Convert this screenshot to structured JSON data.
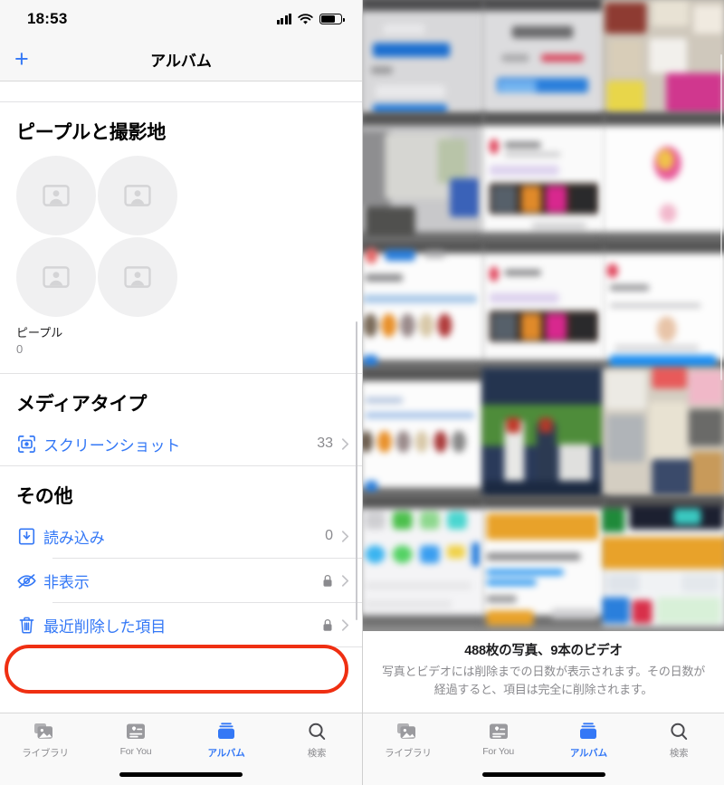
{
  "left": {
    "status": {
      "time": "18:53",
      "signal_icon": "cellular-signal-icon",
      "wifi_icon": "wifi-icon",
      "battery_icon": "battery-icon"
    },
    "nav": {
      "add_label": "+",
      "title": "アルバム"
    },
    "sections": [
      {
        "heading": "ピープルと撮影地",
        "people_album": {
          "label": "ピープル",
          "count": "0"
        }
      },
      {
        "heading": "メディアタイプ",
        "rows": [
          {
            "icon": "screenshot-icon",
            "label": "スクリーンショット",
            "value": "33",
            "locked": false
          }
        ]
      },
      {
        "heading": "その他",
        "rows": [
          {
            "icon": "import-icon",
            "label": "読み込み",
            "value": "0",
            "locked": false
          },
          {
            "icon": "eye-slash-icon",
            "label": "非表示",
            "value": "",
            "locked": true
          },
          {
            "icon": "trash-icon",
            "label": "最近削除した項目",
            "value": "",
            "locked": true
          }
        ]
      }
    ],
    "cut_values": [
      "0",
      "0",
      "0"
    ],
    "highlight": {
      "color": "#ef2f12",
      "target": "最近削除した項目"
    }
  },
  "right": {
    "footer": {
      "title": "488枚の写真、9本のビデオ",
      "description": "写真とビデオには削除までの日数が表示されます。その日数が経過すると、項目は完全に削除されます。"
    }
  },
  "tabs": [
    {
      "label": "ライブラリ",
      "icon": "photos-library-icon",
      "active": false
    },
    {
      "label": "For You",
      "icon": "for-you-icon",
      "active": false
    },
    {
      "label": "アルバム",
      "icon": "albums-icon",
      "active": true
    },
    {
      "label": "検索",
      "icon": "search-icon",
      "active": false
    }
  ],
  "colors": {
    "accent": "#3478f6",
    "highlight": "#ef2f12",
    "secondary_text": "#8a8a8e"
  }
}
